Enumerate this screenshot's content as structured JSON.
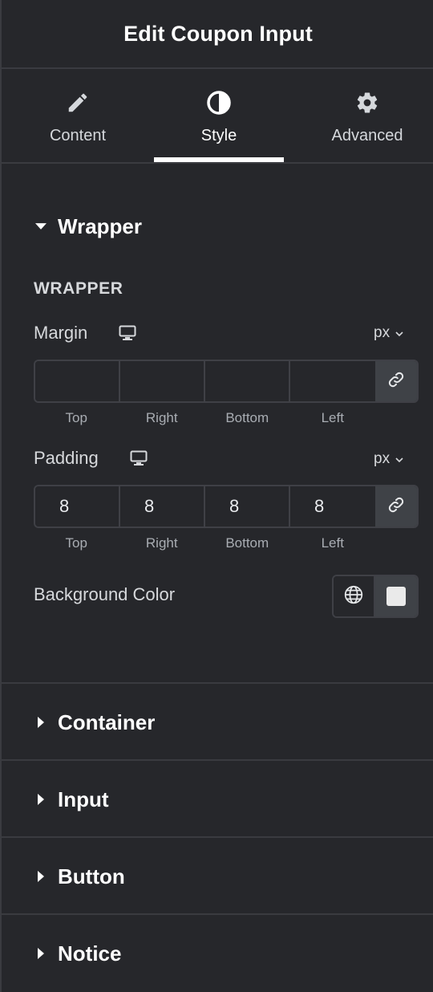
{
  "panel": {
    "title": "Edit Coupon Input"
  },
  "tabs": [
    {
      "label": "Content",
      "icon": "pencil-icon"
    },
    {
      "label": "Style",
      "icon": "contrast-icon",
      "active": true
    },
    {
      "label": "Advanced",
      "icon": "gear-icon"
    }
  ],
  "wrapper_section": {
    "title": "Wrapper",
    "expanded": true,
    "subheading": "WRAPPER",
    "margin": {
      "label": "Margin",
      "unit": "px",
      "values": {
        "top": "",
        "right": "",
        "bottom": "",
        "left": ""
      },
      "labels": [
        "Top",
        "Right",
        "Bottom",
        "Left"
      ]
    },
    "padding": {
      "label": "Padding",
      "unit": "px",
      "values": {
        "top": "8",
        "right": "8",
        "bottom": "8",
        "left": "8"
      },
      "labels": [
        "Top",
        "Right",
        "Bottom",
        "Left"
      ]
    },
    "background": {
      "label": "Background Color",
      "swatch_color": "#eaeaea"
    }
  },
  "sections": [
    {
      "title": "Container"
    },
    {
      "title": "Input"
    },
    {
      "title": "Button"
    },
    {
      "title": "Notice"
    }
  ],
  "colors": {
    "panel_bg": "#26272b",
    "divider": "#3a3b40",
    "text": "#e6e8ea"
  }
}
